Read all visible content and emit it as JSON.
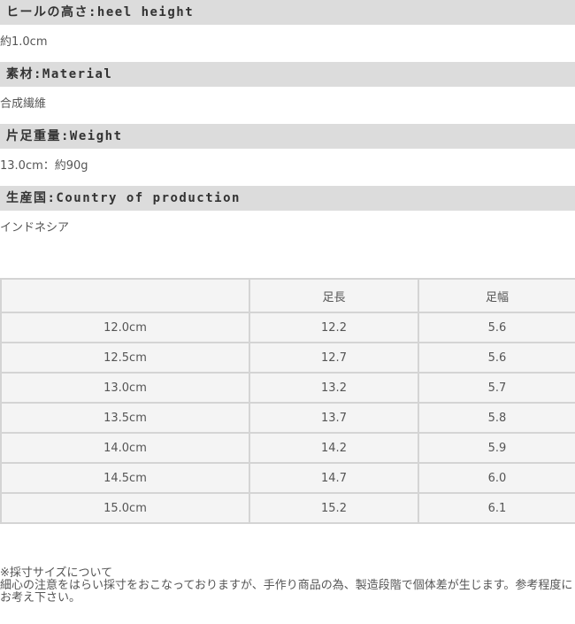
{
  "specs": [
    {
      "label": "ヒールの高さ:heel height",
      "value": "約1.0cm"
    },
    {
      "label": "素材:Material",
      "value": "合成繊維"
    },
    {
      "label": "片足重量:Weight",
      "value": "13.0cm：約90g"
    },
    {
      "label": "生産国:Country of production",
      "value": "インドネシア"
    }
  ],
  "size_table": {
    "headers": [
      "",
      "足長",
      "足幅"
    ],
    "rows": [
      [
        "12.0cm",
        "12.2",
        "5.6"
      ],
      [
        "12.5cm",
        "12.7",
        "5.6"
      ],
      [
        "13.0cm",
        "13.2",
        "5.7"
      ],
      [
        "13.5cm",
        "13.7",
        "5.8"
      ],
      [
        "14.0cm",
        "14.2",
        "5.9"
      ],
      [
        "14.5cm",
        "14.7",
        "6.0"
      ],
      [
        "15.0cm",
        "15.2",
        "6.1"
      ]
    ]
  },
  "note": {
    "title": "※採寸サイズについて",
    "body": "細心の注意をはらい採寸をおこなっておりますが、手作り商品の為、製造段階で個体差が生じます。参考程度にお考え下さい。"
  }
}
